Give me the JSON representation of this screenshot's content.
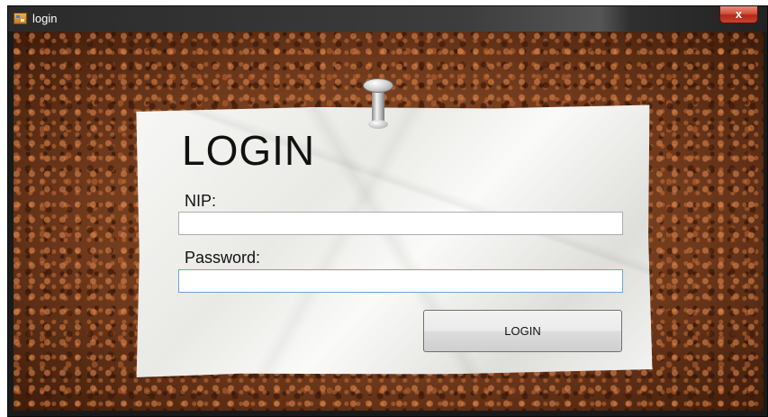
{
  "window": {
    "title": "login",
    "close_label": "x"
  },
  "form": {
    "heading": "LOGIN",
    "nip_label": "NIP:",
    "nip_value": "",
    "password_label": "Password:",
    "password_value": "",
    "submit_label": "LOGIN"
  },
  "icons": {
    "app": "app-window-icon",
    "close": "close-icon",
    "pin": "pushpin-icon"
  }
}
